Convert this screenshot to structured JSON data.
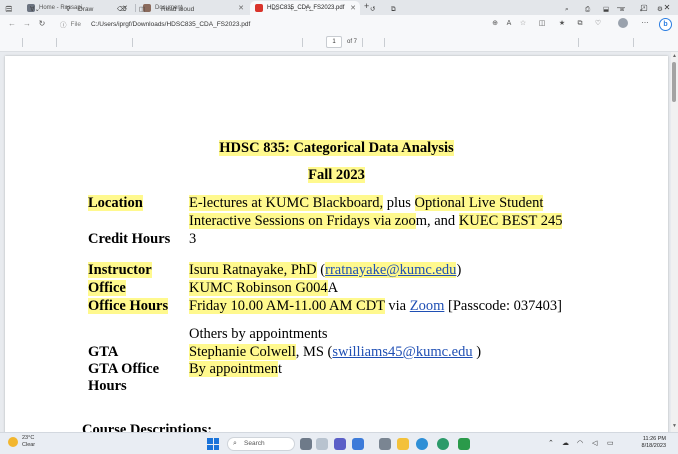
{
  "tabs": [
    {
      "title": "Home - Rossapi"
    },
    {
      "title": "Document"
    },
    {
      "title": "HDSC835_CDA_FS2023.pdf"
    }
  ],
  "address": {
    "file_label": "File",
    "url": "C:/Users/iprgf/Downloads/HDSC835_CDA_FS2023.pdf"
  },
  "pdf_toolbar": {
    "draw_label": "Draw",
    "read_aloud_label": "Read aloud",
    "page_current": "1",
    "page_total": "of 7"
  },
  "document": {
    "title": "HDSC 835: Categorical Data Analysis",
    "term": "Fall 2023",
    "location_label": "Location",
    "location_line1_a": "E-lectures at KUMC Blackboard,",
    "location_line1_b": " plus ",
    "location_line1_c": "Optional Live Student",
    "location_line2_a": "Interactive Sessions on Fridays via zoo",
    "location_line2_b": "m, and ",
    "location_line2_c": "KUEC BEST 245",
    "credit_label": "Credit Hours",
    "credit_value": "3",
    "instructor_label": "Instructor",
    "instructor_name": "Isuru Ratnayake, PhD",
    "instructor_open": " (",
    "instructor_email": "rratnayake@kumc.edu",
    "instructor_close": ")",
    "office_label": "Office",
    "office_value_a": "KUMC Robinson G004",
    "office_value_b": "A",
    "hours_label": "Office Hours",
    "hours_value_a": "Friday 10.00 AM-11.00 AM CDT",
    "hours_value_b": " via ",
    "hours_zoom": "Zoom",
    "hours_passcode": " [Passcode: 037403]",
    "appointments": "Others by appointments",
    "gta_label": "GTA",
    "gta_name": "Stephanie Colwell",
    "gta_mid": ", MS (",
    "gta_email": "swilliams45@kumc.edu",
    "gta_close": " )",
    "gta_office_label": "GTA Office",
    "gta_office_value_a": "By appointmen",
    "gta_office_value_b": "t",
    "gta_hours_label": "Hours",
    "course_desc": "Course Descriptions:"
  },
  "taskbar": {
    "temp": "23°C",
    "weather": "Clear",
    "search_label": "Search",
    "time": "11:26 PM",
    "date": "8/18/2023"
  },
  "colors": {
    "highlight": "#fff98e",
    "link": "#1f4fb4",
    "pdf_tab_icon": "#d9342b"
  }
}
